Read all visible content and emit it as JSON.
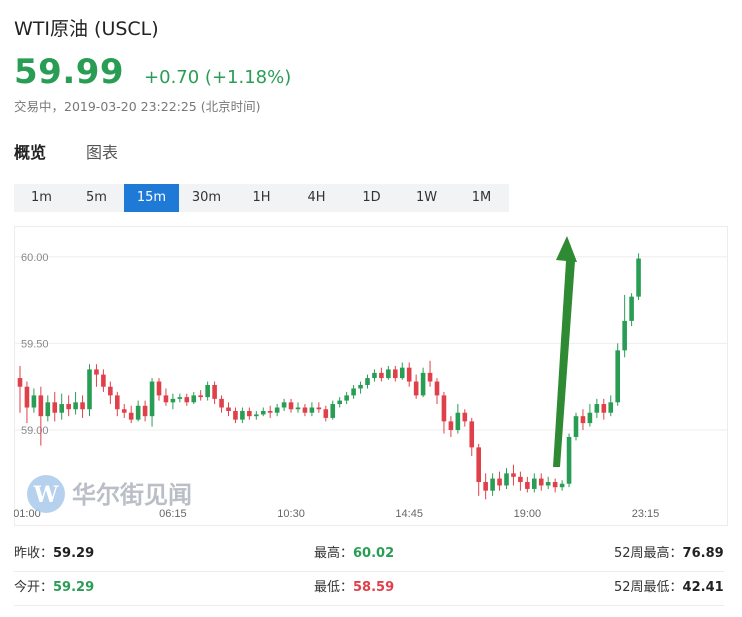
{
  "header": {
    "title": "WTI原油 (USCL)",
    "price": "59.99",
    "change": "+0.70 (+1.18%)",
    "status": "交易中，2019-03-20 23:22:25 (北京时间)"
  },
  "tabs": [
    {
      "label": "概览",
      "active": true
    },
    {
      "label": "图表",
      "active": false
    }
  ],
  "intervals": [
    {
      "label": "1m",
      "active": false
    },
    {
      "label": "5m",
      "active": false
    },
    {
      "label": "15m",
      "active": true
    },
    {
      "label": "30m",
      "active": false
    },
    {
      "label": "1H",
      "active": false
    },
    {
      "label": "4H",
      "active": false
    },
    {
      "label": "1D",
      "active": false
    },
    {
      "label": "1W",
      "active": false
    },
    {
      "label": "1M",
      "active": false
    }
  ],
  "watermark": {
    "text": "华尔街见闻",
    "logo_letter": "W"
  },
  "stats": [
    [
      {
        "label": "昨收：",
        "value": "59.29",
        "color": "dark"
      },
      {
        "label": "最高：",
        "value": "60.02",
        "color": "green"
      },
      {
        "label": "52周最高：",
        "value": "76.89",
        "color": "dark"
      }
    ],
    [
      {
        "label": "今开：",
        "value": "59.29",
        "color": "green"
      },
      {
        "label": "最低：",
        "value": "58.59",
        "color": "red"
      },
      {
        "label": "52周最低：",
        "value": "42.41",
        "color": "dark"
      }
    ]
  ],
  "colors": {
    "up": "#2a9d55",
    "down": "#e0404a",
    "arrow": "#2e8b34",
    "accent": "#1e7ad6"
  },
  "chart_data": {
    "type": "candlestick",
    "y_ticks": [
      60.0,
      59.5,
      59.0
    ],
    "ylim": [
      58.55,
      60.12
    ],
    "x_ticks": [
      {
        "label": "01:00",
        "index": 1
      },
      {
        "label": "06:15",
        "index": 22
      },
      {
        "label": "10:30",
        "index": 39
      },
      {
        "label": "14:45",
        "index": 56
      },
      {
        "label": "19:00",
        "index": 73
      },
      {
        "label": "23:15",
        "index": 90
      }
    ],
    "x_count": 92,
    "annotation": "green upward arrow",
    "candles": [
      [
        59.3,
        59.25,
        59.37,
        59.1
      ],
      [
        59.25,
        59.13,
        59.28,
        59.04
      ],
      [
        59.13,
        59.2,
        59.24,
        59.1
      ],
      [
        59.2,
        59.08,
        59.25,
        58.91
      ],
      [
        59.08,
        59.16,
        59.2,
        59.05
      ],
      [
        59.16,
        59.1,
        59.22,
        59.05
      ],
      [
        59.1,
        59.15,
        59.21,
        59.06
      ],
      [
        59.15,
        59.12,
        59.2,
        59.08
      ],
      [
        59.12,
        59.16,
        59.22,
        59.09
      ],
      [
        59.16,
        59.12,
        59.2,
        59.07
      ],
      [
        59.12,
        59.35,
        59.38,
        59.08
      ],
      [
        59.35,
        59.32,
        59.38,
        59.25
      ],
      [
        59.32,
        59.25,
        59.35,
        59.22
      ],
      [
        59.25,
        59.2,
        59.28,
        59.15
      ],
      [
        59.2,
        59.12,
        59.22,
        59.08
      ],
      [
        59.12,
        59.1,
        59.15,
        59.07
      ],
      [
        59.1,
        59.06,
        59.14,
        59.04
      ],
      [
        59.06,
        59.14,
        59.17,
        59.05
      ],
      [
        59.14,
        59.08,
        59.17,
        59.05
      ],
      [
        59.08,
        59.28,
        59.3,
        59.02
      ],
      [
        59.28,
        59.2,
        59.3,
        59.17
      ],
      [
        59.2,
        59.16,
        59.24,
        59.14
      ],
      [
        59.16,
        59.18,
        59.21,
        59.12
      ],
      [
        59.18,
        59.19,
        59.21,
        59.16
      ],
      [
        59.19,
        59.16,
        59.21,
        59.14
      ],
      [
        59.16,
        59.2,
        59.22,
        59.15
      ],
      [
        59.2,
        59.19,
        59.23,
        59.17
      ],
      [
        59.19,
        59.26,
        59.28,
        59.17
      ],
      [
        59.26,
        59.18,
        59.28,
        59.15
      ],
      [
        59.18,
        59.13,
        59.2,
        59.1
      ],
      [
        59.13,
        59.11,
        59.16,
        59.08
      ],
      [
        59.11,
        59.06,
        59.13,
        59.04
      ],
      [
        59.06,
        59.11,
        59.13,
        59.04
      ],
      [
        59.11,
        59.08,
        59.13,
        59.06
      ],
      [
        59.08,
        59.09,
        59.11,
        59.06
      ],
      [
        59.09,
        59.11,
        59.13,
        59.08
      ],
      [
        59.11,
        59.1,
        59.14,
        59.07
      ],
      [
        59.1,
        59.13,
        59.15,
        59.08
      ],
      [
        59.13,
        59.16,
        59.18,
        59.11
      ],
      [
        59.16,
        59.12,
        59.18,
        59.1
      ],
      [
        59.12,
        59.13,
        59.16,
        59.1
      ],
      [
        59.13,
        59.1,
        59.15,
        59.08
      ],
      [
        59.1,
        59.13,
        59.16,
        59.08
      ],
      [
        59.13,
        59.12,
        59.16,
        59.1
      ],
      [
        59.12,
        59.07,
        59.14,
        59.05
      ],
      [
        59.07,
        59.15,
        59.17,
        59.06
      ],
      [
        59.15,
        59.17,
        59.19,
        59.13
      ],
      [
        59.17,
        59.2,
        59.22,
        59.15
      ],
      [
        59.2,
        59.24,
        59.26,
        59.18
      ],
      [
        59.24,
        59.26,
        59.28,
        59.21
      ],
      [
        59.26,
        59.3,
        59.32,
        59.24
      ],
      [
        59.3,
        59.33,
        59.35,
        59.28
      ],
      [
        59.33,
        59.3,
        59.36,
        59.28
      ],
      [
        59.3,
        59.35,
        59.37,
        59.29
      ],
      [
        59.35,
        59.3,
        59.37,
        59.28
      ],
      [
        59.3,
        59.36,
        59.39,
        59.29
      ],
      [
        59.36,
        59.28,
        59.39,
        59.25
      ],
      [
        59.28,
        59.2,
        59.32,
        59.18
      ],
      [
        59.2,
        59.33,
        59.36,
        59.19
      ],
      [
        59.33,
        59.28,
        59.4,
        59.25
      ],
      [
        59.28,
        59.2,
        59.3,
        59.15
      ],
      [
        59.2,
        59.05,
        59.22,
        58.98
      ],
      [
        59.05,
        59.0,
        59.08,
        58.96
      ],
      [
        59.0,
        59.1,
        59.15,
        58.98
      ],
      [
        59.1,
        59.05,
        59.12,
        59.02
      ],
      [
        59.05,
        58.9,
        59.07,
        58.85
      ],
      [
        58.9,
        58.7,
        58.92,
        58.62
      ],
      [
        58.7,
        58.65,
        58.75,
        58.6
      ],
      [
        58.65,
        58.72,
        58.75,
        58.62
      ],
      [
        58.72,
        58.68,
        58.76,
        58.65
      ],
      [
        58.68,
        58.75,
        58.78,
        58.66
      ],
      [
        58.75,
        58.73,
        58.8,
        58.68
      ],
      [
        58.73,
        58.7,
        58.76,
        58.65
      ],
      [
        58.7,
        58.66,
        58.73,
        58.64
      ],
      [
        58.66,
        58.72,
        58.75,
        58.64
      ],
      [
        58.72,
        58.68,
        58.75,
        58.65
      ],
      [
        58.68,
        58.7,
        58.73,
        58.66
      ],
      [
        58.7,
        58.67,
        58.72,
        58.64
      ],
      [
        58.67,
        58.69,
        58.71,
        58.65
      ],
      [
        58.69,
        58.96,
        58.98,
        58.67
      ],
      [
        58.96,
        59.08,
        59.1,
        58.94
      ],
      [
        59.08,
        59.04,
        59.12,
        59.0
      ],
      [
        59.04,
        59.1,
        59.15,
        59.02
      ],
      [
        59.1,
        59.15,
        59.18,
        59.07
      ],
      [
        59.15,
        59.1,
        59.18,
        59.06
      ],
      [
        59.1,
        59.16,
        59.2,
        59.08
      ],
      [
        59.16,
        59.46,
        59.5,
        59.14
      ],
      [
        59.46,
        59.63,
        59.78,
        59.42
      ],
      [
        59.63,
        59.77,
        59.79,
        59.6
      ],
      [
        59.77,
        59.99,
        60.02,
        59.75
      ]
    ]
  }
}
